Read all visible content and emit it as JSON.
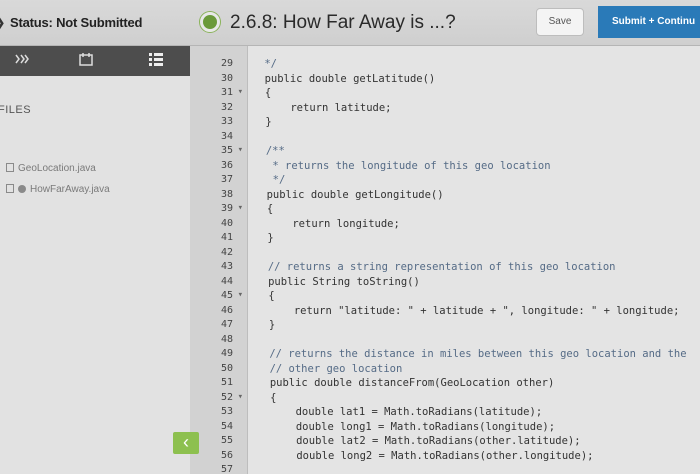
{
  "header": {
    "status_text": "Status: Not Submitted",
    "title": "2.6.8: How Far Away is ...?",
    "save_label": "Save",
    "submit_label": "Submit + Continu"
  },
  "sidebar": {
    "files_label": "FILES",
    "files": [
      {
        "name": "GeoLocation.java"
      },
      {
        "name": "HowFarAway.java"
      }
    ],
    "toolbar_icons": [
      "code-icon",
      "notebook-icon",
      "grid-icon"
    ]
  },
  "editor": {
    "line_numbers": [
      "29",
      "30",
      "31",
      "32",
      "33",
      "34",
      "35",
      "36",
      "37",
      "38",
      "39",
      "40",
      "41",
      "42",
      "43",
      "44",
      "45",
      "46",
      "47",
      "48",
      "49",
      "50",
      "51",
      "52",
      "53",
      "54",
      "55",
      "56",
      "57"
    ],
    "lines": [
      {
        "text": " */",
        "type": "cm"
      },
      {
        "text": " public double getLatitude()",
        "type": "tx"
      },
      {
        "text": " {",
        "type": "tx"
      },
      {
        "text": "     return latitude;",
        "type": "tx"
      },
      {
        "text": " }",
        "type": "tx"
      },
      {
        "text": "",
        "type": "tx"
      },
      {
        "text": " /**",
        "type": "cm"
      },
      {
        "text": "  * returns the longitude of this geo location",
        "type": "cm"
      },
      {
        "text": "  */",
        "type": "cm"
      },
      {
        "text": " public double getLongitude()",
        "type": "tx"
      },
      {
        "text": " {",
        "type": "tx"
      },
      {
        "text": "     return longitude;",
        "type": "tx"
      },
      {
        "text": " }",
        "type": "tx"
      },
      {
        "text": "",
        "type": "tx"
      },
      {
        "text": " // returns a string representation of this geo location",
        "type": "cm"
      },
      {
        "text": " public String toString()",
        "type": "tx"
      },
      {
        "text": " {",
        "type": "tx"
      },
      {
        "text": "     return \"latitude: \" + latitude + \", longitude: \" + longitude;",
        "type": "tx"
      },
      {
        "text": " }",
        "type": "tx"
      },
      {
        "text": "",
        "type": "tx"
      },
      {
        "text": " // returns the distance in miles between this geo location and the",
        "type": "cm"
      },
      {
        "text": " // other geo location",
        "type": "cm"
      },
      {
        "text": " public double distanceFrom(GeoLocation other)",
        "type": "tx"
      },
      {
        "text": " {",
        "type": "tx"
      },
      {
        "text": "     double lat1 = Math.toRadians(latitude);",
        "type": "tx"
      },
      {
        "text": "     double long1 = Math.toRadians(longitude);",
        "type": "tx"
      },
      {
        "text": "     double lat2 = Math.toRadians(other.latitude);",
        "type": "tx"
      },
      {
        "text": "     double long2 = Math.toRadians(other.longitude);",
        "type": "tx"
      },
      {
        "text": "",
        "type": "tx"
      }
    ]
  },
  "colors": {
    "submit_bg": "#2a7ab8",
    "collapse_bg": "#8dc04f",
    "toolbar_bg": "#4d4d4d"
  }
}
